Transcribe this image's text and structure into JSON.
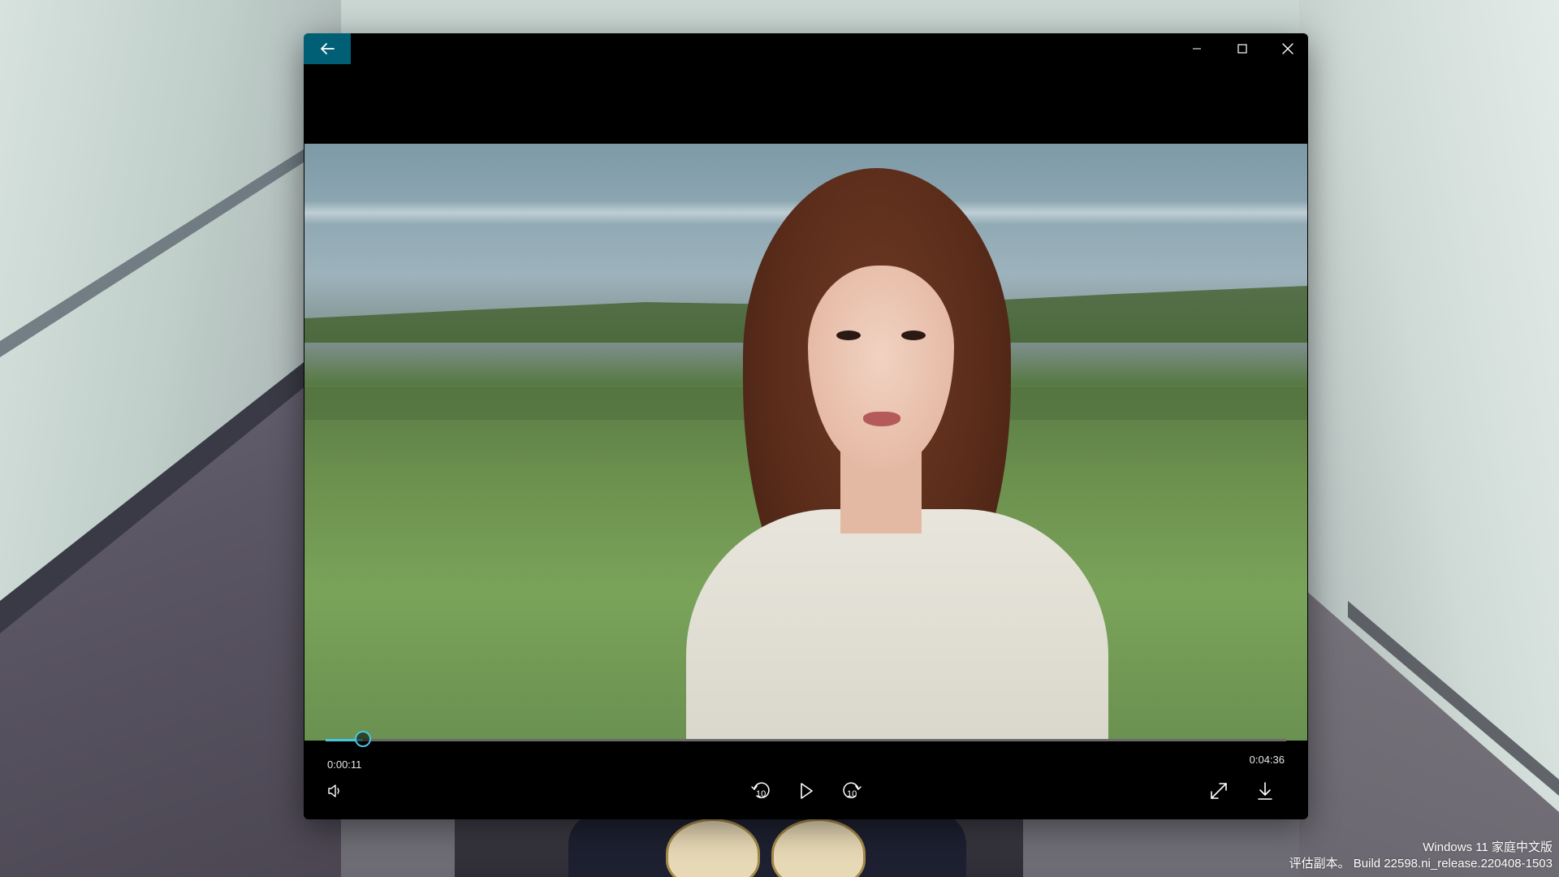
{
  "player": {
    "progress_fraction": 0.039,
    "elapsed_time": "0:00:11",
    "total_time": "0:04:36",
    "skip_back_seconds": "10",
    "skip_forward_seconds": "10",
    "accent_color": "#48c6e0",
    "icons": {
      "back": "arrow-left-icon",
      "minimize": "minimize-icon",
      "maximize": "maximize-icon",
      "close": "close-icon",
      "volume": "volume-icon",
      "skip_back": "rewind-10-icon",
      "play": "play-icon",
      "skip_forward": "forward-10-icon",
      "fullscreen": "fullscreen-icon",
      "download": "download-icon"
    }
  },
  "watermark": {
    "line1": "Windows 11 家庭中文版",
    "line2": "评估副本。 Build 22598.ni_release.220408-1503"
  }
}
